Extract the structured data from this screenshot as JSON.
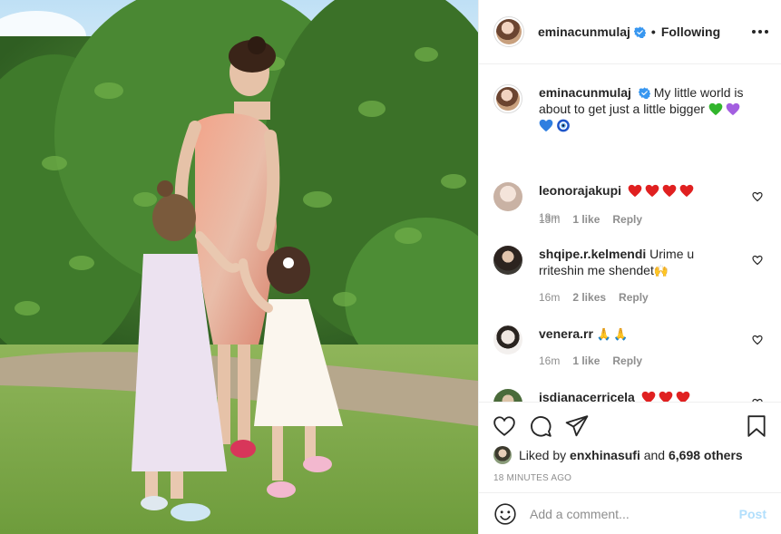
{
  "post": {
    "author": "eminacunmulaj",
    "follow_status": "Following",
    "verified": true,
    "more_icon": "more-options-icon"
  },
  "caption": {
    "username": "eminacunmulaj",
    "text": "My little world is about to get just a little bigger",
    "emojis": [
      "green-heart",
      "purple-heart",
      "blue-heart",
      "nazar-amulet"
    ],
    "time": "18m"
  },
  "comments": [
    {
      "username": "leonorajakupi",
      "text": "",
      "emojis": [
        "red-heart",
        "red-heart",
        "red-heart",
        "red-heart"
      ],
      "time": "13m",
      "likes": "1 like",
      "reply": "Reply"
    },
    {
      "username": "shqipe.r.kelmendi",
      "text": "Urime u rriteshin me shendet",
      "emojis": [
        "raised-hands"
      ],
      "time": "16m",
      "likes": "2 likes",
      "reply": "Reply"
    },
    {
      "username": "venera.rr",
      "text": "",
      "emojis": [
        "folded-hands",
        "folded-hands"
      ],
      "time": "16m",
      "likes": "1 like",
      "reply": "Reply"
    },
    {
      "username": "isdianacerricela",
      "text": "",
      "emojis": [
        "red-heart",
        "red-heart",
        "red-heart"
      ],
      "time": "",
      "likes": "",
      "reply": ""
    }
  ],
  "actions": {
    "icons": [
      "like-heart-icon",
      "comment-icon",
      "share-icon",
      "save-bookmark-icon"
    ],
    "liked_by_prefix": "Liked by",
    "liked_by_user": "enxhinasufi",
    "liked_by_and": "and",
    "liked_by_others": "6,698 others",
    "time_ago": "18 minutes ago"
  },
  "add_comment": {
    "placeholder": "Add a comment...",
    "post_label": "Post"
  },
  "colors": {
    "verified_blue": "#3897f0",
    "post_button_disabled": "#b2dffc",
    "heart_red": "#e02020"
  }
}
